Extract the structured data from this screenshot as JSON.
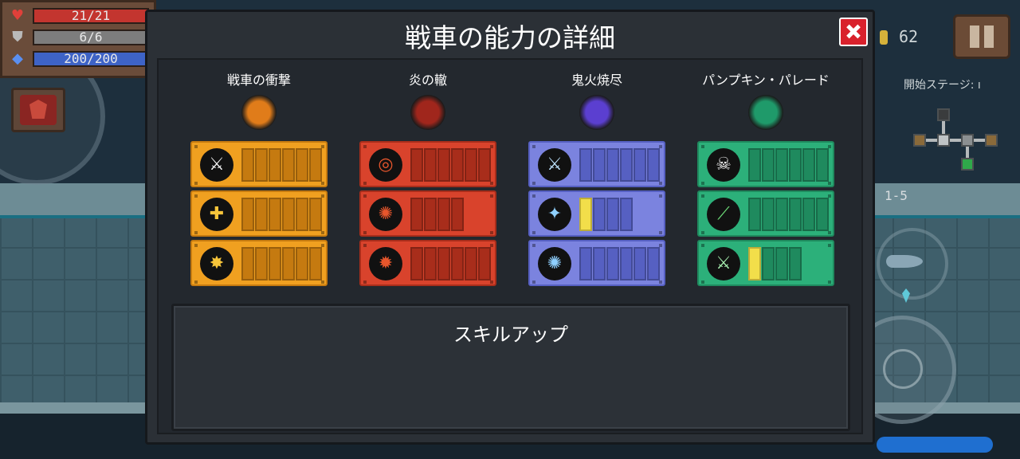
{
  "hud": {
    "hp": "21/21",
    "armor": "6/6",
    "energy": "200/200",
    "coins": "62",
    "stage_label": "開始ステージ: ı",
    "level": "1-5"
  },
  "modal": {
    "title": "戦車の能力の詳細",
    "close_icon": "close-icon",
    "info_title": "スキルアップ"
  },
  "columns": [
    {
      "title": "戦車の衝撃",
      "color": "#f0a020",
      "dark": "#c57a10",
      "emblem": "#e07c1a",
      "skills": [
        {
          "icon": "sword-icon",
          "glyph": "⚔",
          "glyph_color": "#f5f5f5",
          "level": 0,
          "max": 6
        },
        {
          "icon": "plus-icon",
          "glyph": "✚",
          "glyph_color": "#f7c53a",
          "level": 0,
          "max": 6
        },
        {
          "icon": "burst-icon",
          "glyph": "✸",
          "glyph_color": "#f7c53a",
          "level": 0,
          "max": 6
        }
      ]
    },
    {
      "title": "炎の轍",
      "color": "#d9432c",
      "dark": "#a82d1b",
      "emblem": "#a0261c",
      "skills": [
        {
          "icon": "fire-swirl-icon",
          "glyph": "◎",
          "glyph_color": "#e7562c",
          "level": 0,
          "max": 6
        },
        {
          "icon": "fire-spread-icon",
          "glyph": "✺",
          "glyph_color": "#e7562c",
          "level": 0,
          "max": 4
        },
        {
          "icon": "fire-burst-icon",
          "glyph": "✹",
          "glyph_color": "#e7562c",
          "level": 0,
          "max": 6
        }
      ]
    },
    {
      "title": "鬼火焼尽",
      "color": "#7b83df",
      "dark": "#5660c2",
      "emblem": "#5b3fd0",
      "skills": [
        {
          "icon": "ghost-sword-icon",
          "glyph": "⚔",
          "glyph_color": "#bfe4ff",
          "level": 0,
          "max": 6
        },
        {
          "icon": "ghost-flame-icon",
          "glyph": "✦",
          "glyph_color": "#8fd0ff",
          "level": 1,
          "max": 4
        },
        {
          "icon": "ghost-orb-icon",
          "glyph": "✺",
          "glyph_color": "#8fd0ff",
          "level": 0,
          "max": 6
        }
      ]
    },
    {
      "title": "パンプキン・パレード",
      "color": "#2cb07a",
      "dark": "#1f8a5e",
      "emblem": "#1f9a6a",
      "skills": [
        {
          "icon": "skull-icon",
          "glyph": "☠",
          "glyph_color": "#f5f5f5",
          "level": 0,
          "max": 6
        },
        {
          "icon": "green-blade-icon",
          "glyph": "⟋",
          "glyph_color": "#6fe07a",
          "level": 0,
          "max": 6
        },
        {
          "icon": "green-sword-icon",
          "glyph": "⚔",
          "glyph_color": "#a8f0b0",
          "level": 1,
          "max": 4
        }
      ]
    }
  ],
  "colors": {
    "highlight": "#f2de4a",
    "modal_bg": "#2b3036",
    "close": "#d9212c"
  }
}
